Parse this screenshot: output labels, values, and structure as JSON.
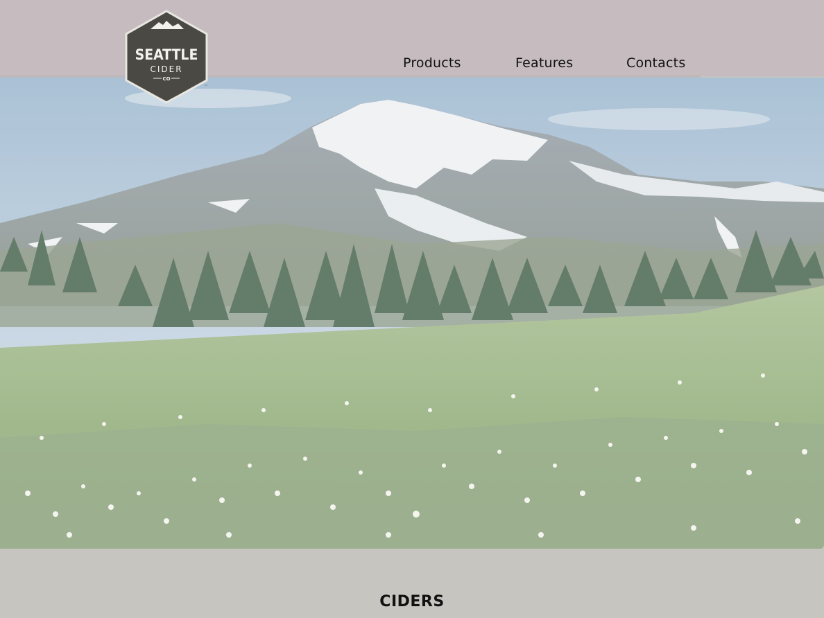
{
  "brand": {
    "logo_line1": "SEATTLE",
    "logo_line2": "CIDER",
    "logo_line3": "CO",
    "logo_tm": "™",
    "logo_color": "#4a4943"
  },
  "nav": {
    "items": [
      {
        "label": "Products"
      },
      {
        "label": "Features"
      },
      {
        "label": "Contacts"
      }
    ]
  },
  "hero": {
    "image": "mountain-meadow-landscape"
  },
  "main": {
    "section_title": "CIDERS"
  },
  "colors": {
    "header_bg": "#c6bcc0",
    "page_bg": "#c6c5c0"
  }
}
